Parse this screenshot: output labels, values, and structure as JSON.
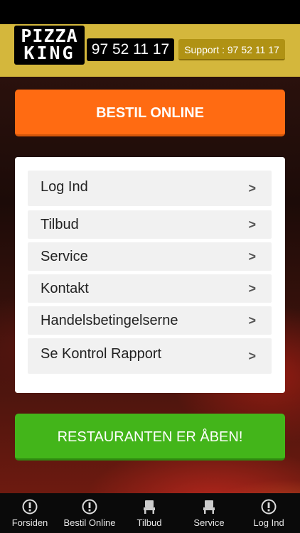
{
  "header": {
    "logo_line1": "PIZZA",
    "logo_line2": "KING",
    "phone": "97 52 11 17",
    "support": "Support : 97 52 11 17"
  },
  "order_button": "BESTIL ONLINE",
  "menu": {
    "items": [
      {
        "label": "Log Ind"
      },
      {
        "label": "Tilbud"
      },
      {
        "label": "Service"
      },
      {
        "label": "Kontakt"
      },
      {
        "label": "Handelsbetingelserne"
      },
      {
        "label": "Se Kontrol Rapport"
      }
    ],
    "chevron": ">"
  },
  "status_button": "RESTAURANTEN ER ÅBEN!",
  "tabbar": {
    "tabs": [
      {
        "label": "Forsiden",
        "icon": "info-icon"
      },
      {
        "label": "Bestil Online",
        "icon": "info-icon"
      },
      {
        "label": "Tilbud",
        "icon": "chair-icon"
      },
      {
        "label": "Service",
        "icon": "chair-icon"
      },
      {
        "label": "Log Ind",
        "icon": "info-icon"
      }
    ]
  },
  "colors": {
    "header": "#d4b73c",
    "order": "#ff6b12",
    "open": "#43b51a"
  }
}
